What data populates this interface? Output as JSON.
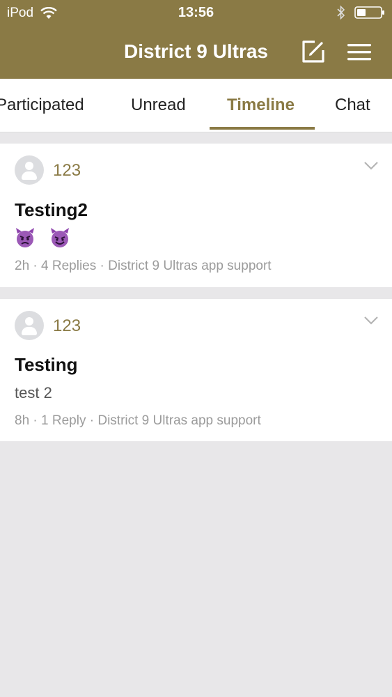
{
  "status_bar": {
    "carrier": "iPod",
    "time": "13:56"
  },
  "header": {
    "title": "District 9 Ultras",
    "compose_icon": "compose-icon",
    "menu_icon": "hamburger-menu-icon"
  },
  "tabs": [
    {
      "label": "Participated",
      "active": false
    },
    {
      "label": "Unread",
      "active": false
    },
    {
      "label": "Timeline",
      "active": true
    },
    {
      "label": "Chat",
      "active": false
    }
  ],
  "posts": [
    {
      "username": "123",
      "title": "Testing2",
      "body_emoji": [
        "angry-devil-emoji",
        "smiling-devil-emoji"
      ],
      "meta": {
        "time": "2h",
        "replies": "4 Replies",
        "forum": "District 9 Ultras app support"
      }
    },
    {
      "username": "123",
      "title": "Testing",
      "body": "test 2",
      "meta": {
        "time": "8h",
        "replies": "1 Reply",
        "forum": "District 9 Ultras app support"
      }
    }
  ],
  "colors": {
    "brand": "#8a7a45",
    "background": "#e8e7e9",
    "meta_text": "#9b9b9b"
  }
}
